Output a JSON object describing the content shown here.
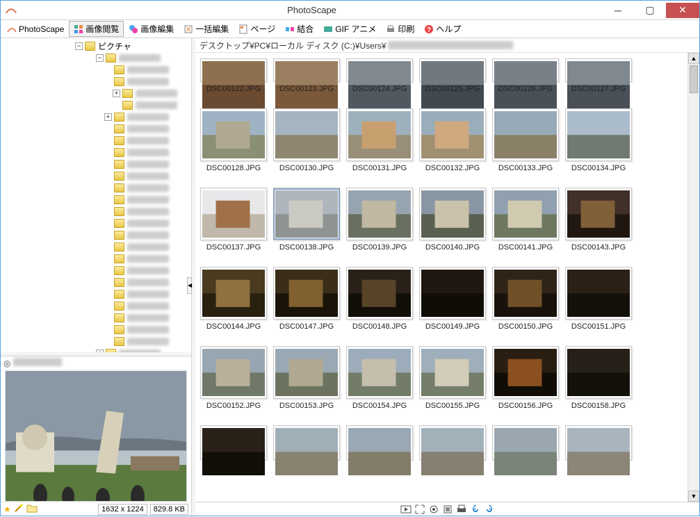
{
  "window": {
    "title": "PhotoScape"
  },
  "toolbar": {
    "tabs": [
      {
        "label": "PhotoScape",
        "icon": "photoscape-icon"
      },
      {
        "label": "画像閲覧",
        "icon": "viewer-icon",
        "active": true
      },
      {
        "label": "画像編集",
        "icon": "editor-icon"
      },
      {
        "label": "一括編集",
        "icon": "batch-icon"
      },
      {
        "label": "ページ",
        "icon": "page-icon"
      },
      {
        "label": "結合",
        "icon": "combine-icon"
      },
      {
        "label": "GIF アニメ",
        "icon": "gif-icon"
      },
      {
        "label": "印刷",
        "icon": "print-icon"
      },
      {
        "label": "ヘルプ",
        "icon": "help-icon"
      }
    ]
  },
  "tree": {
    "root_label": "ピクチャ"
  },
  "breadcrumb": {
    "path": "デスクトップ¥PC¥ローカル ディスク (C:)¥Users¥"
  },
  "thumbnails": {
    "row0": [
      "DSC00122.JPG",
      "DSC00123.JPG",
      "DSC00124.JPG",
      "DSC00125.JPG",
      "DSC00126.JPG",
      "DSC00127.JPG"
    ],
    "row1": [
      "DSC00128.JPG",
      "DSC00130.JPG",
      "DSC00131.JPG",
      "DSC00132.JPG",
      "DSC00133.JPG",
      "DSC00134.JPG"
    ],
    "row2": [
      "DSC00137.JPG",
      "DSC00138.JPG",
      "DSC00139.JPG",
      "DSC00140.JPG",
      "DSC00141.JPG",
      "DSC00143.JPG"
    ],
    "row3": [
      "DSC00144.JPG",
      "DSC00147.JPG",
      "DSC00148.JPG",
      "DSC00149.JPG",
      "DSC00150.JPG",
      "DSC00151.JPG"
    ],
    "row4": [
      "DSC00152.JPG",
      "DSC00153.JPG",
      "DSC00154.JPG",
      "DSC00155.JPG",
      "DSC00156.JPG",
      "DSC00158.JPG"
    ],
    "selected_index": 7
  },
  "preview": {
    "dimensions": "1632 x 1224",
    "filesize": "829.8 KB"
  },
  "status_icons": [
    "slideshow",
    "fullscreen",
    "fit",
    "actual",
    "print",
    "rotate-left",
    "rotate-right"
  ]
}
